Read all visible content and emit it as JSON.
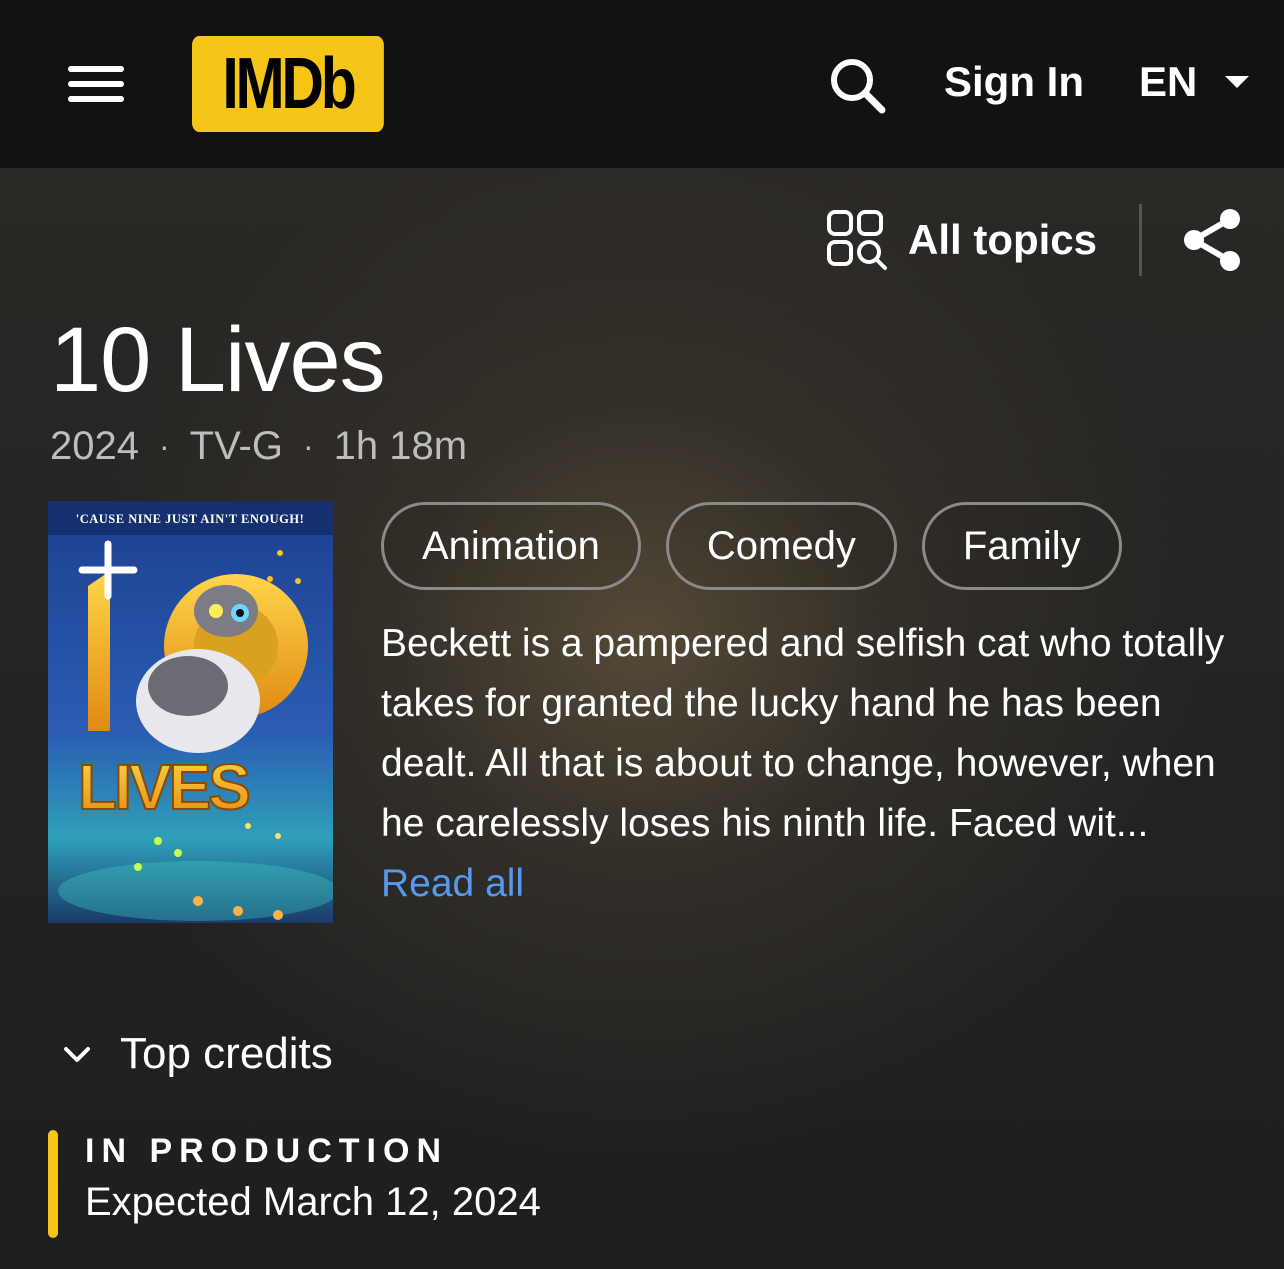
{
  "nav": {
    "logo": "IMDb",
    "sign_in": "Sign In",
    "language": "EN"
  },
  "toolbar": {
    "all_topics": "All topics"
  },
  "title": {
    "name": "10 Lives",
    "year": "2024",
    "rating": "TV-G",
    "runtime": "1h 18m"
  },
  "poster": {
    "tagline": "'Cause Nine Just Ain't Enough!",
    "logo_text": "LIVES"
  },
  "genres": [
    "Animation",
    "Comedy",
    "Family"
  ],
  "plot": {
    "text": "Beckett is a pampered and selfish cat who totally takes for granted the lucky hand he has been dealt. All that is about to change, however, when he carelessly loses his ninth life. Faced wit... ",
    "read_all": "Read all"
  },
  "credits": {
    "label": "Top credits"
  },
  "production": {
    "status": "IN PRODUCTION",
    "expected": "Expected March 12, 2024"
  },
  "colors": {
    "accent": "#f5c518",
    "link": "#5799ef",
    "nav_bg": "#121212"
  }
}
